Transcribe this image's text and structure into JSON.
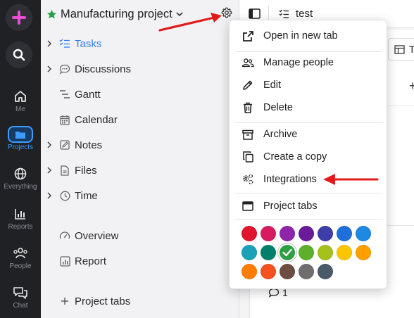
{
  "rail": {
    "items": [
      {
        "label": "Me"
      },
      {
        "label": "Projects"
      },
      {
        "label": "Everything"
      },
      {
        "label": "Reports"
      },
      {
        "label": "People"
      },
      {
        "label": "Chat"
      }
    ]
  },
  "project": {
    "title": "Manufacturing project"
  },
  "sidebar": {
    "items": [
      {
        "label": "Tasks"
      },
      {
        "label": "Discussions"
      },
      {
        "label": "Gantt"
      },
      {
        "label": "Calendar"
      },
      {
        "label": "Notes"
      },
      {
        "label": "Files"
      },
      {
        "label": "Time"
      },
      {
        "label": "Overview"
      },
      {
        "label": "Report"
      }
    ],
    "add_tabs_label": "Project tabs"
  },
  "content": {
    "tab_title": "test",
    "table_tab_letter": "T",
    "add_symbol": "+",
    "comment_count": "1"
  },
  "menu": {
    "items": [
      {
        "label": "Open in new tab",
        "icon": "open-external-icon"
      },
      {
        "label": "Manage people",
        "icon": "people-icon"
      },
      {
        "label": "Edit",
        "icon": "pencil-icon"
      },
      {
        "label": "Delete",
        "icon": "trash-icon"
      },
      {
        "label": "Archive",
        "icon": "archive-icon"
      },
      {
        "label": "Create a copy",
        "icon": "copy-icon"
      },
      {
        "label": "Integrations",
        "icon": "gears-icon"
      },
      {
        "label": "Project tabs",
        "icon": "tabs-icon"
      }
    ],
    "colors": [
      "#e0142b",
      "#d81b60",
      "#8e24aa",
      "#6a1b9a",
      "#3f3ea8",
      "#1e6fd9",
      "#1e88e5",
      "#1aa3b8",
      "#00806b",
      "#2ea043",
      "#5cb02a",
      "#a6c21a",
      "#ffc400",
      "#ffa000",
      "#ff7d00",
      "#f4511e",
      "#6d4c41",
      "#6e6e6e",
      "#4a5a69"
    ],
    "selected_color": "#2ea043"
  },
  "colors": {
    "accent": "#2f80ed",
    "rail_bg": "#1f2125",
    "annotation_arrow": "#e01b1b"
  }
}
